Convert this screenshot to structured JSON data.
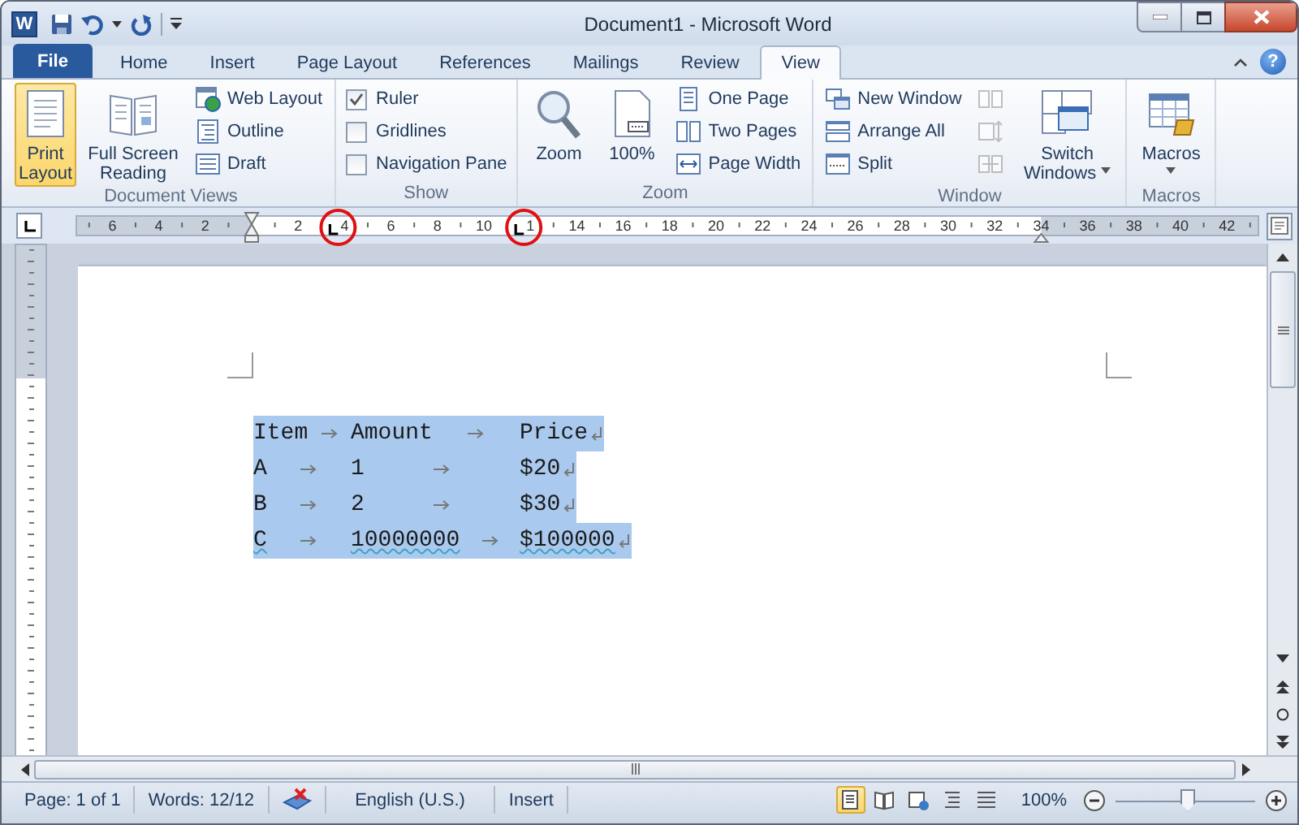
{
  "window": {
    "logo": "W",
    "title": "Document1 - Microsoft Word",
    "help": "?"
  },
  "tabs": [
    {
      "label": "File",
      "kind": "file",
      "selected": false
    },
    {
      "label": "Home",
      "kind": "tab",
      "selected": false
    },
    {
      "label": "Insert",
      "kind": "tab",
      "selected": false
    },
    {
      "label": "Page Layout",
      "kind": "tab",
      "selected": false
    },
    {
      "label": "References",
      "kind": "tab",
      "selected": false
    },
    {
      "label": "Mailings",
      "kind": "tab",
      "selected": false
    },
    {
      "label": "Review",
      "kind": "tab",
      "selected": false
    },
    {
      "label": "View",
      "kind": "tab",
      "selected": true
    }
  ],
  "ribbon": {
    "groups": [
      {
        "label": "Document Views",
        "items": [
          {
            "kind": "large",
            "label": "Print Layout",
            "selected": true
          },
          {
            "kind": "large",
            "label": "Full Screen Reading",
            "selected": false
          },
          {
            "kind": "small",
            "label": "Web Layout"
          },
          {
            "kind": "small",
            "label": "Outline"
          },
          {
            "kind": "small",
            "label": "Draft"
          }
        ]
      },
      {
        "label": "Show",
        "items": [
          {
            "kind": "check",
            "label": "Ruler",
            "checked": true
          },
          {
            "kind": "check",
            "label": "Gridlines",
            "checked": false
          },
          {
            "kind": "check",
            "label": "Navigation Pane",
            "checked": false
          }
        ]
      },
      {
        "label": "Zoom",
        "items": [
          {
            "kind": "large",
            "label": "Zoom",
            "selected": false
          },
          {
            "kind": "large",
            "label": "100%",
            "selected": false
          },
          {
            "kind": "small",
            "label": "One Page"
          },
          {
            "kind": "small",
            "label": "Two Pages"
          },
          {
            "kind": "small",
            "label": "Page Width"
          }
        ]
      },
      {
        "label": "Window",
        "items": [
          {
            "kind": "small",
            "label": "New Window"
          },
          {
            "kind": "small",
            "label": "Arrange All"
          },
          {
            "kind": "small",
            "label": "Split"
          },
          {
            "kind": "icon",
            "disabled": true
          },
          {
            "kind": "icon",
            "disabled": true
          },
          {
            "kind": "icon",
            "disabled": true
          },
          {
            "kind": "large",
            "label": "Switch Windows",
            "selected": false,
            "menu": true
          }
        ]
      },
      {
        "label": "Macros",
        "items": [
          {
            "kind": "large",
            "label": "Macros",
            "selected": false,
            "menu": true
          }
        ]
      }
    ]
  },
  "ruler": {
    "numbers": [
      "6",
      "4",
      "2",
      "2",
      "4",
      "6",
      "8",
      "10",
      "1",
      "14",
      "16",
      "18",
      "20",
      "22",
      "24",
      "26",
      "28",
      "30",
      "32",
      "34",
      "36",
      "38",
      "40",
      "42"
    ]
  },
  "document": {
    "rows": [
      {
        "cells": [
          "Item",
          "Amount",
          "Price"
        ],
        "selected": true,
        "grammar_flag": false
      },
      {
        "cells": [
          "A",
          "1",
          "$20"
        ],
        "selected": true,
        "grammar_flag": false
      },
      {
        "cells": [
          "B",
          "2",
          "$30"
        ],
        "selected": true,
        "grammar_flag": false
      },
      {
        "cells": [
          "C",
          "10000000",
          "$100000"
        ],
        "selected": true,
        "grammar_flag": true
      }
    ]
  },
  "status_bar": {
    "page": "Page: 1 of 1",
    "words": "Words: 12/12",
    "language": "English (U.S.)",
    "mode": "Insert",
    "views": [
      {
        "selected": true
      },
      {
        "selected": false
      },
      {
        "selected": false
      },
      {
        "selected": false
      },
      {
        "selected": false
      }
    ],
    "zoom": {
      "label": "100%",
      "level": 0.5
    }
  }
}
